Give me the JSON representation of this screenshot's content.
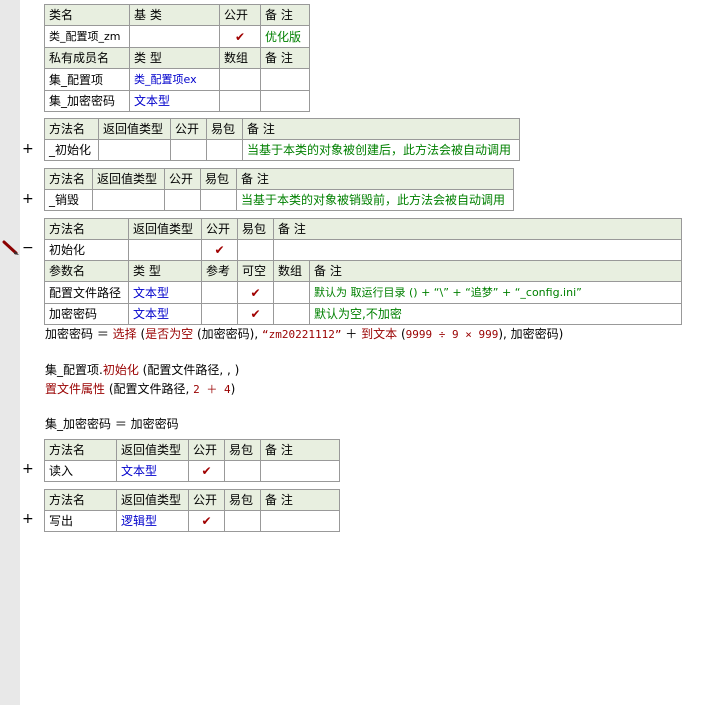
{
  "class_table": {
    "headers": [
      "类名",
      "基 类",
      "公开",
      "备 注"
    ],
    "row": {
      "name": "类_配置项_zm",
      "base": "",
      "public": "✔",
      "note": "优化版"
    }
  },
  "members_table": {
    "headers": [
      "私有成员名",
      "类 型",
      "数组",
      "备 注"
    ],
    "rows": [
      {
        "name": "集_配置项",
        "type": "类_配置项ex"
      },
      {
        "name": "集_加密密码",
        "type": "文本型"
      }
    ]
  },
  "method_headers": [
    "方法名",
    "返回值类型",
    "公开",
    "易包",
    "备 注"
  ],
  "param_headers": [
    "参数名",
    "类 型",
    "参考",
    "可空",
    "数组",
    "备 注"
  ],
  "methods": {
    "init": {
      "expand": "+",
      "name": "_初始化",
      "note": "当基于本类的对象被创建后，此方法会被自动调用"
    },
    "destroy": {
      "expand": "+",
      "name": "_销毁",
      "note": "当基于本类的对象被销毁前，此方法会被自动调用"
    },
    "init2": {
      "expand": "−",
      "name": "初始化",
      "public": "✔",
      "params": [
        {
          "name": "配置文件路径",
          "type": "文本型",
          "nullable": "✔",
          "note": "默认为 取运行目录 () + “\\” + “追梦” + “_config.ini”"
        },
        {
          "name": "加密密码",
          "type": "文本型",
          "nullable": "✔",
          "note": "默认为空,不加密"
        }
      ]
    },
    "read": {
      "expand": "+",
      "name": "读入",
      "ret": "文本型",
      "public": "✔"
    },
    "write": {
      "expand": "+",
      "name": "写出",
      "ret": "逻辑型",
      "public": "✔"
    }
  },
  "code": {
    "l1_a": "加密密码 ＝ ",
    "l1_b": "选择",
    "l1_c": " (",
    "l1_d": "是否为空",
    "l1_e": " (加密密码), ",
    "l1_f": "“zm20221112”",
    "l1_g": " ＋ ",
    "l1_h": "到文本",
    "l1_i": " (",
    "l1_j": "9999 ÷ 9 × 999",
    "l1_k": "), 加密密码)",
    "l2_a": "集_配置项.",
    "l2_b": "初始化",
    "l2_c": " (配置文件路径, , )",
    "l3_a": "置文件属性",
    "l3_b": " (配置文件路径, ",
    "l3_c": "2 ＋ 4",
    "l3_d": ")",
    "l4": "集_加密密码 ＝ 加密密码"
  }
}
